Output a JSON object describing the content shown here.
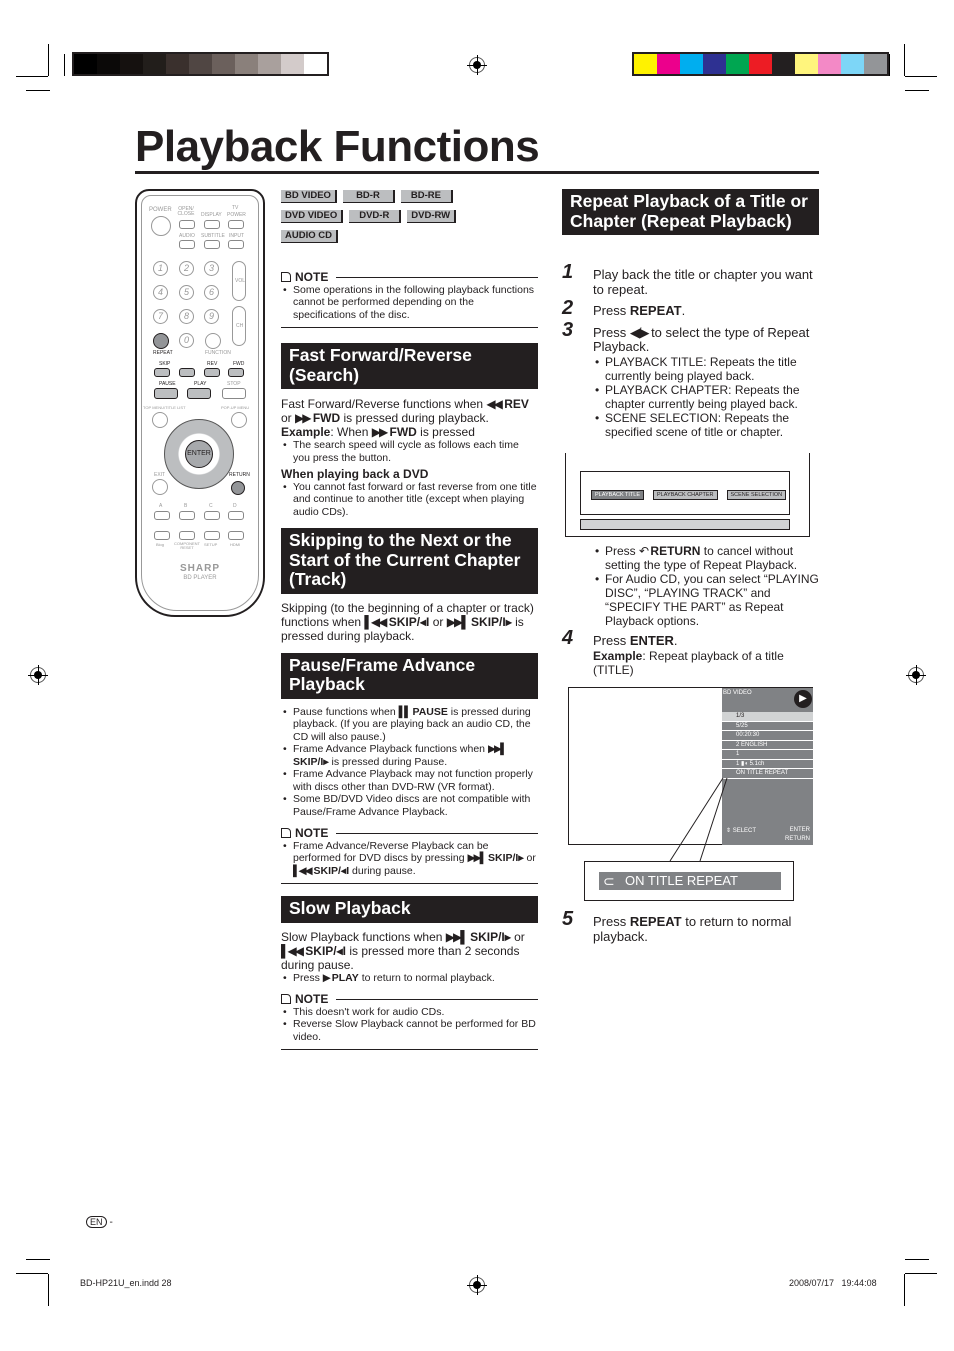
{
  "print_marks": {
    "gray_swatches": [
      "#000000",
      "#0b0908",
      "#15110f",
      "#221e1b",
      "#3a302d",
      "#504643",
      "#6b605c",
      "#8a807b",
      "#a9a09d",
      "#d3cbca",
      "#ffffff"
    ],
    "color_swatches": [
      "#fff200",
      "#ec008c",
      "#00aeef",
      "#2e3192",
      "#00a651",
      "#ed1c24",
      "#231f20",
      "#fff57d",
      "#f389c6",
      "#7dd6f7",
      "#939598"
    ]
  },
  "page_title": "Playback Functions",
  "remote": {
    "labels": {
      "power": "POWER",
      "open_close": "OPEN/ CLOSE",
      "display": "DISPLAY",
      "tv": "TV",
      "tv_power": "POWER",
      "audio": "AUDIO",
      "subtitle": "SUBTITLE",
      "input": "INPUT",
      "vol": "VOL",
      "ch": "CH",
      "repeat": "REPEAT",
      "function": "FUNCTION",
      "skip": "SKIP",
      "rev": "REV",
      "fwd": "FWD",
      "pause": "PAUSE",
      "play": "PLAY",
      "stop": "STOP",
      "top_menu": "TOP MENU/TITLE LIST",
      "popup_menu": "POP-UP MENU",
      "enter": "ENTER",
      "exit": "EXIT",
      "return": "RETURN",
      "a": "A",
      "b": "B",
      "c": "C",
      "d": "D",
      "bluetooth": "Blog",
      "component_reset": "COMPONENT RESET",
      "setup": "SETUP",
      "hdmi": "HDMI",
      "brand": "SHARP",
      "model": "BD PLAYER"
    },
    "numbers": [
      "1",
      "2",
      "3",
      "4",
      "5",
      "6",
      "7",
      "8",
      "9",
      "0"
    ]
  },
  "discs": [
    [
      "BD VIDEO",
      "BD-R",
      "BD-RE"
    ],
    [
      "DVD VIDEO",
      "DVD-R",
      "DVD-RW"
    ],
    [
      "AUDIO CD"
    ]
  ],
  "note_label": "NOTE",
  "note1": [
    "Some operations in the following playback functions cannot be performed depending on the specifications of the disc."
  ],
  "ff": {
    "title": "Fast Forward/Reverse (Search)",
    "body": [
      {
        "t": "Fast Forward/Reverse functions when "
      },
      {
        "i": "◀◀"
      },
      {
        "b": " REV"
      },
      {
        "t": " or "
      },
      {
        "i": "▶▶"
      },
      {
        "b": " FWD"
      },
      {
        "t": " is pressed during playback."
      }
    ],
    "example": [
      {
        "b": "Example"
      },
      {
        "t": ": When "
      },
      {
        "i": "▶▶"
      },
      {
        "b": " FWD"
      },
      {
        "t": " is pressed"
      }
    ],
    "bullets": [
      "The search speed will cycle as follows each time you press the button."
    ],
    "sub": "When playing back a DVD",
    "sub_bullets": [
      "You cannot fast forward or fast reverse from one title and continue to another title (except when playing audio CDs)."
    ]
  },
  "skip": {
    "title": "Skipping to the Next or the Start of the Current Chapter (Track)",
    "body": [
      {
        "t": "Skipping (to the beginning of a chapter or track) functions when "
      },
      {
        "i": "▌◀◀"
      },
      {
        "b": " SKIP/◂I"
      },
      {
        "t": " or "
      },
      {
        "i": "▶▶▌"
      },
      {
        "b": " SKIP/I▸"
      },
      {
        "t": " is pressed during playback."
      }
    ]
  },
  "pause": {
    "title": "Pause/Frame Advance Playback",
    "bullets": [
      [
        {
          "t": "Pause functions when "
        },
        {
          "i": "▌▌"
        },
        {
          "b": " PAUSE"
        },
        {
          "t": " is pressed during playback. (If you are playing back an audio CD, the CD will also pause.)"
        }
      ],
      [
        {
          "t": "Frame Advance Playback functions when "
        },
        {
          "i": "▶▶▌"
        },
        {
          "b": " SKIP/I▸"
        },
        {
          "t": " is pressed during Pause."
        }
      ],
      [
        {
          "t": "Frame Advance Playback may not function properly with discs other than DVD-RW (VR format)."
        }
      ],
      [
        {
          "t": "Some BD/DVD Video discs are not compatible with Pause/Frame Advance Playback."
        }
      ]
    ],
    "note": [
      [
        {
          "t": "Frame Advance/Reverse Playback can be performed for DVD discs by pressing "
        },
        {
          "i": "▶▶▌"
        },
        {
          "b": "  SKIP/I▸"
        },
        {
          "t": " or "
        },
        {
          "i": "▌◀◀"
        },
        {
          "b": "  SKIP/◂I"
        },
        {
          "t": " during pause."
        }
      ]
    ]
  },
  "slow": {
    "title": "Slow Playback",
    "body": [
      {
        "t": "Slow Playback functions when "
      },
      {
        "i": "▶▶▌"
      },
      {
        "b": "  SKIP/I▸"
      },
      {
        "t": " or "
      },
      {
        "i": "▌◀◀"
      },
      {
        "b": "  SKIP/◂I"
      },
      {
        "t": " is pressed more than 2 seconds during pause."
      }
    ],
    "bullets": [
      [
        {
          "t": "Press "
        },
        {
          "i": "▶"
        },
        {
          "b": " PLAY"
        },
        {
          "t": " to return to normal playback."
        }
      ]
    ],
    "note": [
      [
        {
          "t": "This doesn't work for audio CDs."
        }
      ],
      [
        {
          "t": "Reverse Slow Playback cannot be performed for BD video."
        }
      ]
    ]
  },
  "repeat": {
    "title": "Repeat Playback of a Title or Chapter (Repeat Playback)",
    "steps": [
      {
        "n": "1",
        "text": [
          {
            "t": "Play back the title or chapter you want to repeat."
          }
        ]
      },
      {
        "n": "2",
        "text": [
          {
            "t": "Press "
          },
          {
            "b": "REPEAT"
          },
          {
            "t": "."
          }
        ]
      },
      {
        "n": "3",
        "text": [
          {
            "t": "Press "
          },
          {
            "i": "◀/▶"
          },
          {
            "t": " to select the type of Repeat Playback."
          }
        ],
        "bullets": [
          [
            {
              "t": "PLAYBACK TITLE: Repeats the title currently being played back."
            }
          ],
          [
            {
              "t": "PLAYBACK CHAPTER: Repeats the chapter currently being played back."
            }
          ],
          [
            {
              "t": "SCENE SELECTION: Repeats the specified scene of title or chapter."
            }
          ]
        ]
      },
      {
        "n": "4",
        "text": [
          {
            "t": "Press "
          },
          {
            "b": "ENTER"
          },
          {
            "t": "."
          }
        ],
        "example": [
          {
            "b": "Example"
          },
          {
            "t": ": Repeat playback of a title (TITLE)"
          }
        ]
      },
      {
        "n": "5",
        "text": [
          {
            "t": "Press "
          },
          {
            "b": "REPEAT"
          },
          {
            "t": " to return to normal playback."
          }
        ]
      }
    ],
    "menu_options": [
      "PLAYBACK TITLE",
      "PLAYBACK CHAPTER",
      "SCENE SELECTION"
    ],
    "after3": [
      [
        {
          "t": "Press "
        },
        {
          "i": "↶"
        },
        {
          "b": " RETURN"
        },
        {
          "t": " to cancel without setting the type of Repeat Playback."
        }
      ],
      [
        {
          "t": "For Audio CD, you can select “PLAYING DISC”, “PLAYING TRACK” and “SPECIFY THE PART” as Repeat Playback options."
        }
      ]
    ],
    "osd": {
      "header": "BD VIDEO",
      "rows": [
        "1/3",
        "5/25",
        "00:20:30",
        "2 ENGLISH",
        "1",
        "1  ▮◖  5.1ch",
        "ON TITLE REPEAT"
      ],
      "select": "SELECT",
      "enter": "ENTER",
      "return": "RETURN",
      "callout": "ON TITLE REPEAT"
    }
  },
  "footer": {
    "lang": "EN",
    "dash": "-",
    "file": "BD-HP21U_en.indd   28",
    "date": "2008/07/17   19:44:08"
  }
}
